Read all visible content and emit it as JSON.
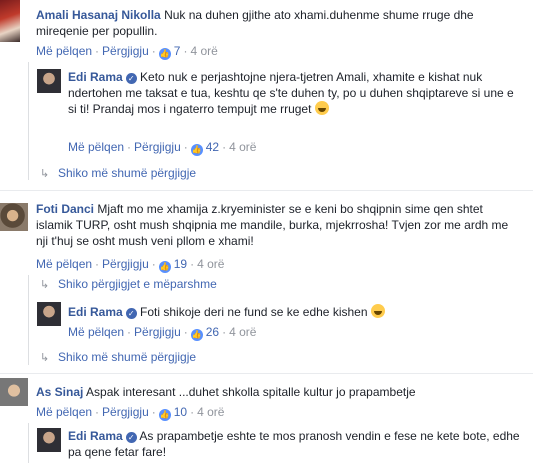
{
  "comments": [
    {
      "author": "Amali Hasanaj Nikolla",
      "text": "Nuk na duhen gjithe ato xhami.duhenme shume rruge dhe mireqenie per popullin.",
      "like": "Më pëlqen",
      "reply": "Përgjigju",
      "reactions": "7",
      "time": "4 orë",
      "replies": [
        {
          "author": "Edi Rama",
          "text": "Keto nuk e perjashtojne njera-tjetren Amali, xhamite e kishat nuk ndertohen me taksat e tua, keshtu qe s'te duhen ty, po u duhen shqiptareve si une e si ti! Prandaj mos i ngaterro tempujt me rruget",
          "like": "Më pëlqen",
          "reply": "Përgjigju",
          "reactions": "42",
          "time": "4 orë"
        }
      ],
      "more_replies": "Shiko më shumë përgjigje"
    },
    {
      "author": "Foti Danci",
      "text": "Mjaft mo me xhamija z.kryeminister se e keni bo shqipnin sime qen shtet islamik TURP, osht mush shqipnia me mandile, burka, mjekrrosha! Tvjen zor me ardh me nji t'huj se osht mush veni pllom e xhami!",
      "like": "Më pëlqen",
      "reply": "Përgjigju",
      "reactions": "19",
      "time": "4 orë",
      "previous_replies": "Shiko përgjigjet e mëparshme",
      "replies": [
        {
          "author": "Edi Rama",
          "text": "Foti shikoje deri ne fund se ke edhe kishen",
          "like": "Më pëlqen",
          "reply": "Përgjigju",
          "reactions": "26",
          "time": "4 orë"
        }
      ],
      "more_replies": "Shiko më shumë përgjigje"
    },
    {
      "author": "As Sinaj",
      "text": "Aspak interesant ...duhet shkolla spitalle kultur jo prapambetje",
      "like": "Më pëlqen",
      "reply": "Përgjigju",
      "reactions": "10",
      "time": "4 orë",
      "replies": [
        {
          "author": "Edi Rama",
          "text": "As prapambetje eshte te mos pranosh vendin e fese ne kete bote, edhe pa qene fetar fare!"
        }
      ]
    }
  ],
  "colors": {
    "link": "#365899",
    "action": "#4267b2",
    "meta": "#90949c",
    "like_badge": "#5890ff"
  }
}
